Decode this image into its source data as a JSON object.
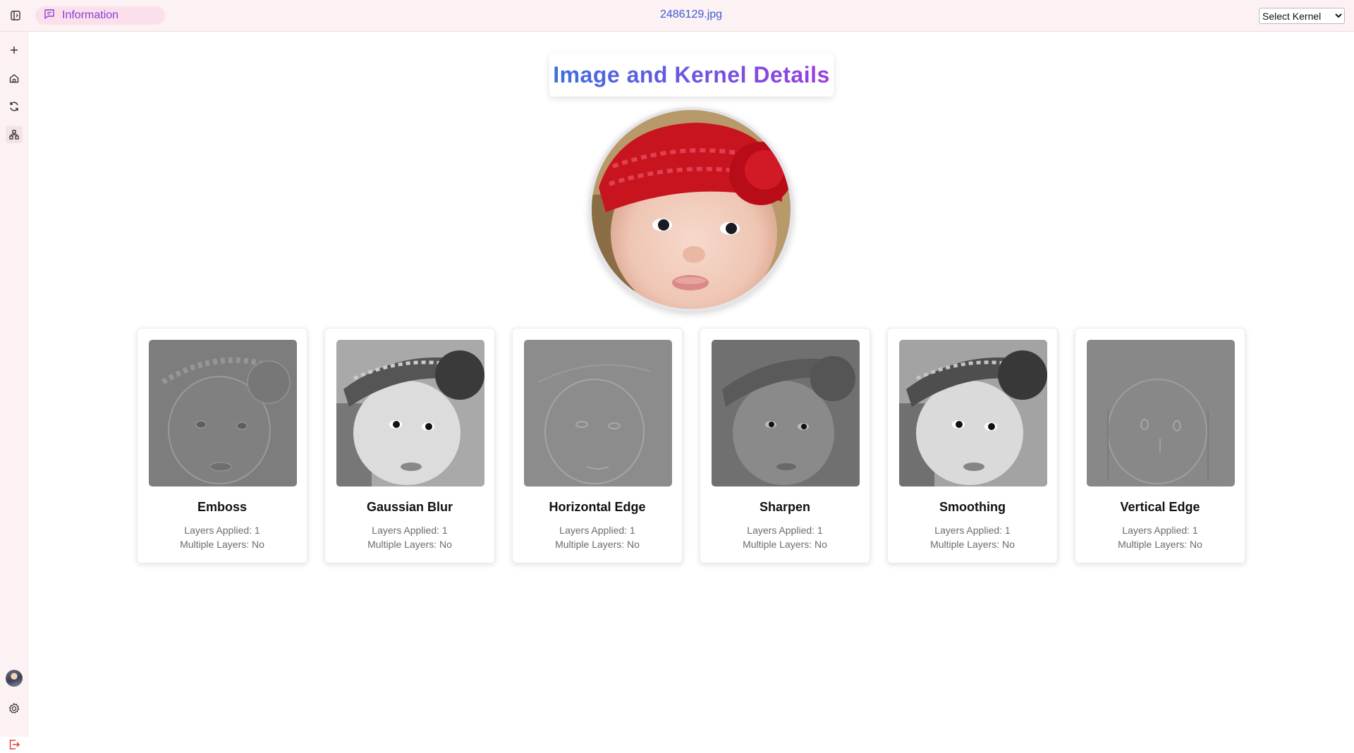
{
  "header": {
    "tab_label": "Information",
    "filename": "2486129.jpg",
    "kernel_select": {
      "selected": "Select Kernel"
    }
  },
  "sidebar": {
    "icons": [
      "panel-toggle-icon",
      "plus-icon",
      "home-icon",
      "refresh-icon",
      "hierarchy-icon",
      "avatar",
      "gear-icon",
      "logout-icon"
    ]
  },
  "main": {
    "title": "Image and Kernel Details",
    "kernels": [
      {
        "name": "Emboss",
        "layers": "Layers Applied: 1",
        "multiple": "Multiple Layers: No"
      },
      {
        "name": "Gaussian Blur",
        "layers": "Layers Applied: 1",
        "multiple": "Multiple Layers: No"
      },
      {
        "name": "Horizontal Edge",
        "layers": "Layers Applied: 1",
        "multiple": "Multiple Layers: No"
      },
      {
        "name": "Sharpen",
        "layers": "Layers Applied: 1",
        "multiple": "Multiple Layers: No"
      },
      {
        "name": "Smoothing",
        "layers": "Layers Applied: 1",
        "multiple": "Multiple Layers: No"
      },
      {
        "name": "Vertical Edge",
        "layers": "Layers Applied: 1",
        "multiple": "Multiple Layers: No"
      }
    ]
  },
  "colors": {
    "header_bg": "#fdf2f3",
    "tab_pill_bg": "#fbe0ec",
    "tab_text": "#8b3dd6",
    "filename_text": "#3b5bd6",
    "title_gradient_start": "#3d6fe0",
    "title_gradient_end": "#9b3de0",
    "logout_icon": "#e04040"
  }
}
